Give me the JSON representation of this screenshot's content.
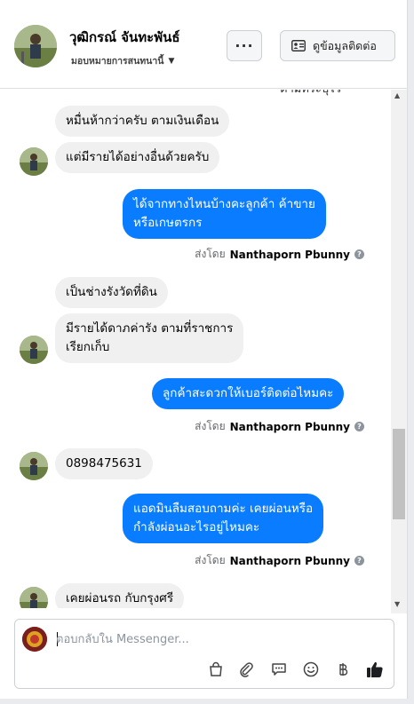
{
  "header": {
    "name": "วุฒิกรณ์ จันทะพันธ์",
    "assign_label": "มอบหมายการสนทนานี้",
    "more_label": "···",
    "contact_label": "ดูข้อมูลติดต่อ"
  },
  "thread": {
    "cut_text": "ตามที่ระบุไว้",
    "messages": [
      {
        "text": "หมื่นห้ากว่าครับ ตามเงินเดือน"
      },
      {
        "text": "แต่มีรายได้อย่างอื่นด้วยครับ"
      },
      {
        "text_l1": "ได้จากทางไหนบ้างคะลูกค้า ค้าขาย",
        "text_l2": "หรือเกษตรกร"
      },
      {
        "text": "เป็นช่างรังวัดที่ดิน"
      },
      {
        "text_l1": "มีรายได้ดาภค่ารัง ตามที่ราชการ",
        "text_l2": "เรียกเก็บ"
      },
      {
        "text": "ลูกค้าสะดวกให้เบอร์ติดต่อไหมคะ"
      },
      {
        "text": "0898475631"
      },
      {
        "text_l1": "แอดมินลืมสอบถามค่ะ เคยผ่อนหรือ",
        "text_l2": "กำลังผ่อนอะไรอยู่ไหมคะ"
      },
      {
        "text": "เคยผ่อนรถ กับกรุงศรี"
      }
    ],
    "sent_by_label": "ส่งโดย",
    "sender_name": "Nanthaporn Pbunny",
    "help_icon": "?"
  },
  "composer": {
    "placeholder": "ตอบกลับใน Messenger..."
  },
  "colors": {
    "outgoing": "#0a7cff",
    "incoming": "#f0f0f0",
    "like": "#1c1e21"
  }
}
